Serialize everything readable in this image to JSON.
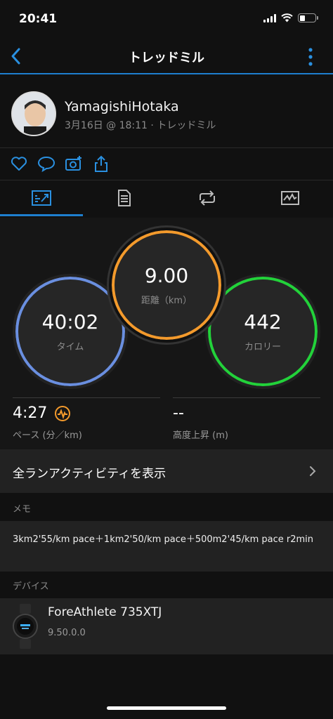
{
  "status_bar": {
    "time": "20:41"
  },
  "nav": {
    "title": "トレッドミル"
  },
  "profile": {
    "name": "YamagishiHotaka",
    "meta": "3月16日 @ 18:11 · トレッドミル"
  },
  "tabs": [
    "summary-tab",
    "details-tab",
    "laps-tab",
    "charts-tab"
  ],
  "metrics": {
    "time": {
      "value": "40:02",
      "label": "タイム",
      "color": "#6f8fe0"
    },
    "distance": {
      "value": "9.00",
      "label": "距離（km）",
      "color": "#f39a2c"
    },
    "calories": {
      "value": "442",
      "label": "カロリー",
      "color": "#22d23a"
    }
  },
  "stats": {
    "pace": {
      "value": "4:27",
      "label": "ペース (分／km)"
    },
    "elevation": {
      "value": "--",
      "label": "高度上昇 (m)"
    }
  },
  "all_activities": "全ランアクティビティを表示",
  "memo": {
    "label": "メモ",
    "text": "3km2'55/km pace＋1km2'50/km pace＋500m2'45/km pace r2min"
  },
  "device": {
    "label": "デバイス",
    "name": "ForeAthlete 735XTJ",
    "version": "9.50.0.0"
  },
  "colors": {
    "accent": "#1e7fcf",
    "background": "#111111"
  }
}
